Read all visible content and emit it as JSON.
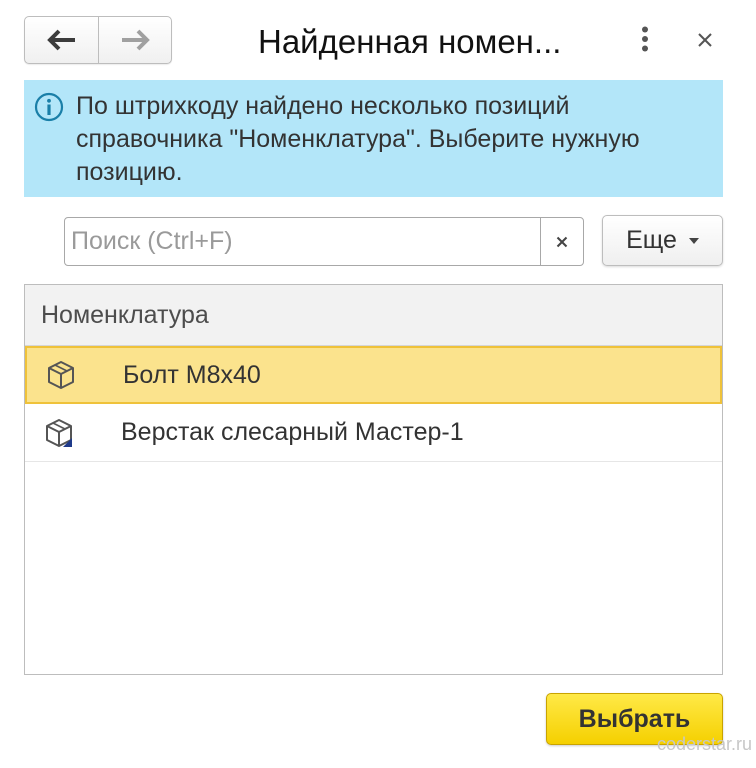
{
  "header": {
    "title": "Найденная номен...",
    "back_icon": "arrow-left-icon",
    "forward_icon": "arrow-right-icon",
    "more_icon": "kebab-menu-icon",
    "close_icon": "close-icon"
  },
  "info": {
    "icon": "info-icon",
    "text": "По штрихкоду найдено несколько позиций справочника \"Номенклатура\". Выберите нужную позицию."
  },
  "search": {
    "value": "",
    "placeholder": "Поиск (Ctrl+F)",
    "clear_icon": "clear-icon"
  },
  "more_menu": {
    "label": "Еще",
    "icon": "dropdown-arrow-icon"
  },
  "table": {
    "columns": [
      "Номенклатура"
    ],
    "rows": [
      {
        "label": "Болт М8х40",
        "icon": "package-icon",
        "selected": true
      },
      {
        "label": "Верстак слесарный Мастер-1",
        "icon": "package-marked-icon",
        "selected": false
      }
    ]
  },
  "footer": {
    "choose_label": "Выбрать",
    "watermark": "coderstar.ru"
  },
  "colors": {
    "info_background": "#b3e6f9",
    "selected_row": "#fbe38d",
    "selected_border": "#efc23a",
    "primary_button": "#f5d000"
  }
}
